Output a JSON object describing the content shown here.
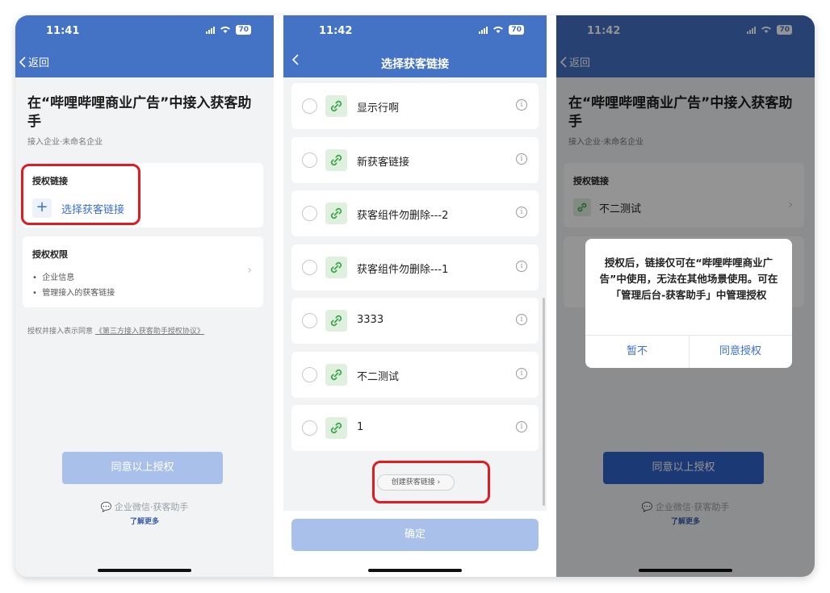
{
  "screen1": {
    "time": "11:41",
    "battery": "70",
    "back_label": "返回",
    "title": "在“哔哩哔哩商业广告”中接入获客助手",
    "subtitle": "接入企业·未命名企业",
    "auth_link_title": "授权链接",
    "auth_link_action": "选择获客链接",
    "permission_title": "授权权限",
    "permissions": [
      "企业信息",
      "管理接入的获客链接"
    ],
    "agreement_prefix": "授权并接入表示同意",
    "agreement_link": "《第三方接入获客助手授权协议》",
    "agree_button": "同意以上授权",
    "brand": "企业微信·获客助手",
    "learn_more": "了解更多"
  },
  "screen2": {
    "time": "11:42",
    "battery": "70",
    "title": "选择获客链接",
    "links": [
      {
        "name": "显示行啊"
      },
      {
        "name": "新获客链接"
      },
      {
        "name": "获客组件勿删除---2"
      },
      {
        "name": "获客组件勿删除---1"
      },
      {
        "name": "3333"
      },
      {
        "name": "不二测试"
      },
      {
        "name": "1"
      }
    ],
    "create_link": "创建获客链接",
    "confirm_button": "确定"
  },
  "screen3": {
    "time": "11:42",
    "battery": "70",
    "back_label": "返回",
    "title": "在“哔哩哔哩商业广告”中接入获客助手",
    "subtitle": "接入企业·未命名企业",
    "auth_link_title": "授权链接",
    "selected_link": "不二测试",
    "dialog_message": "授权后，链接仅可在“哔哩哔哩商业广告”中使用，无法在其他场景使用。可在「管理后台-获客助手」中管理授权",
    "dialog_cancel": "暂不",
    "dialog_confirm": "同意授权",
    "agree_button": "同意以上授权",
    "brand": "企业微信·获客助手",
    "learn_more": "了解更多"
  },
  "colors": {
    "header": "#4472c4",
    "accent": "#3b6ed5",
    "highlight": "#e01b22",
    "disabled_button": "#a9c1ea",
    "active_button": "#2f62c9"
  },
  "icons": [
    "back-chevron-icon",
    "plus-icon",
    "link-icon",
    "info-icon",
    "chevron-right-icon",
    "chat-bubble-icon",
    "signal-icon",
    "wifi-icon",
    "battery-icon"
  ]
}
